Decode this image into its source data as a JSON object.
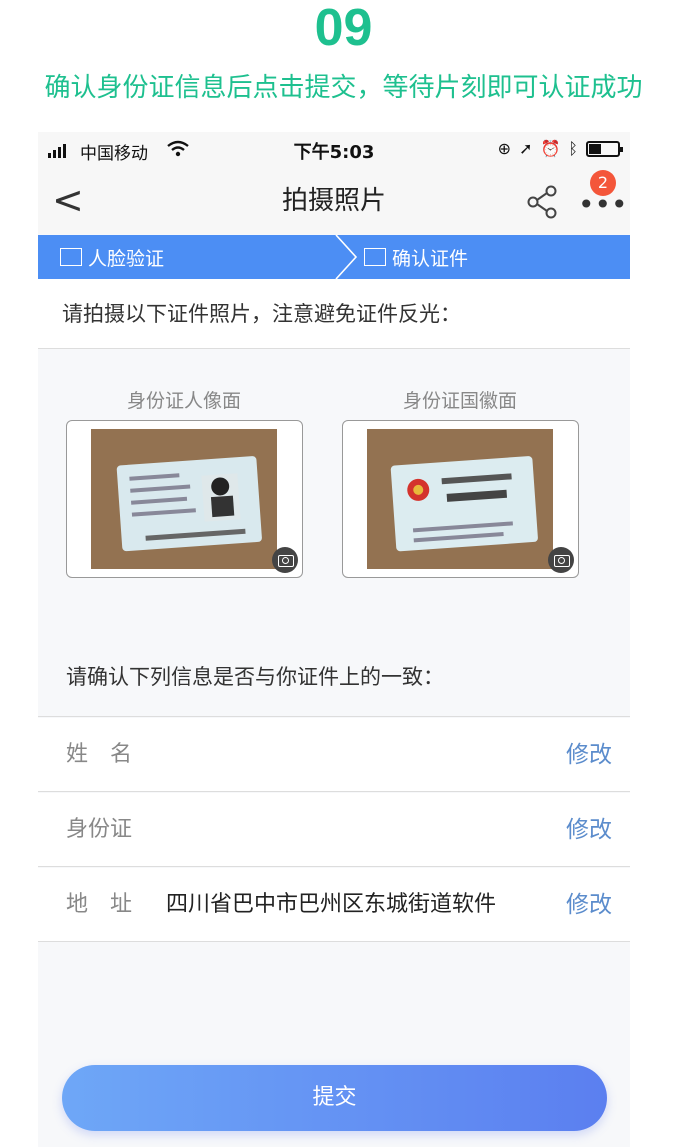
{
  "step": {
    "number": "09",
    "description": "确认身份证信息后点击提交，等待片刻即可认证成功"
  },
  "status_bar": {
    "carrier": "中国移动",
    "time": "下午5:03"
  },
  "nav": {
    "back": "<",
    "title": "拍摄照片",
    "badge": "2"
  },
  "progress_steps": [
    {
      "label": "人脸验证"
    },
    {
      "label": "确认证件"
    }
  ],
  "photo_hint": "请拍摄以下证件照片，注意避免证件反光：",
  "cards": [
    {
      "label": "身份证人像面"
    },
    {
      "label": "身份证国徽面"
    }
  ],
  "confirm_hint": "请确认下列信息是否与你证件上的一致：",
  "fields": [
    {
      "label": "姓　名",
      "value": "",
      "action": "修改"
    },
    {
      "label": "身份证",
      "value": "",
      "action": "修改"
    },
    {
      "label": "地　址",
      "value": "四川省巴中市巴州区东城街道软件",
      "action": "修改"
    }
  ],
  "submit_label": "提交",
  "colors": {
    "accent_green": "#1ec08f",
    "step_bar_blue": "#4c8ef4",
    "link_blue": "#5b8ccc",
    "badge_red": "#f4563a"
  }
}
